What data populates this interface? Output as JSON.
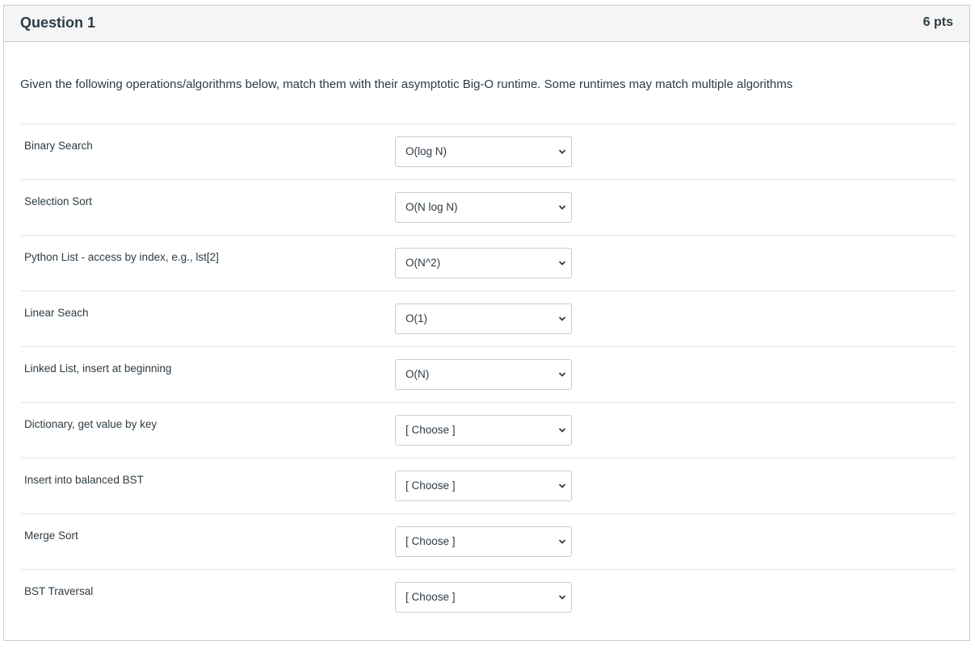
{
  "question": {
    "title": "Question 1",
    "points": "6 pts",
    "text": "Given the following operations/algorithms below, match them with their asymptotic Big-O runtime. Some runtimes may match multiple algorithms"
  },
  "rows": [
    {
      "label": "Binary Search",
      "selected": "O(log N)"
    },
    {
      "label": "Selection Sort",
      "selected": "O(N log N)"
    },
    {
      "label": "Python List - access by index, e.g., lst[2]",
      "selected": "O(N^2)"
    },
    {
      "label": "Linear Seach",
      "selected": "O(1)"
    },
    {
      "label": "Linked List, insert at beginning",
      "selected": "O(N)"
    },
    {
      "label": "Dictionary, get value by key",
      "selected": "[ Choose ]"
    },
    {
      "label": "Insert into balanced BST",
      "selected": "[ Choose ]"
    },
    {
      "label": "Merge Sort",
      "selected": "[ Choose ]"
    },
    {
      "label": "BST Traversal",
      "selected": "[ Choose ]"
    }
  ],
  "icons": {
    "dropdown": "chevron-down-icon"
  }
}
